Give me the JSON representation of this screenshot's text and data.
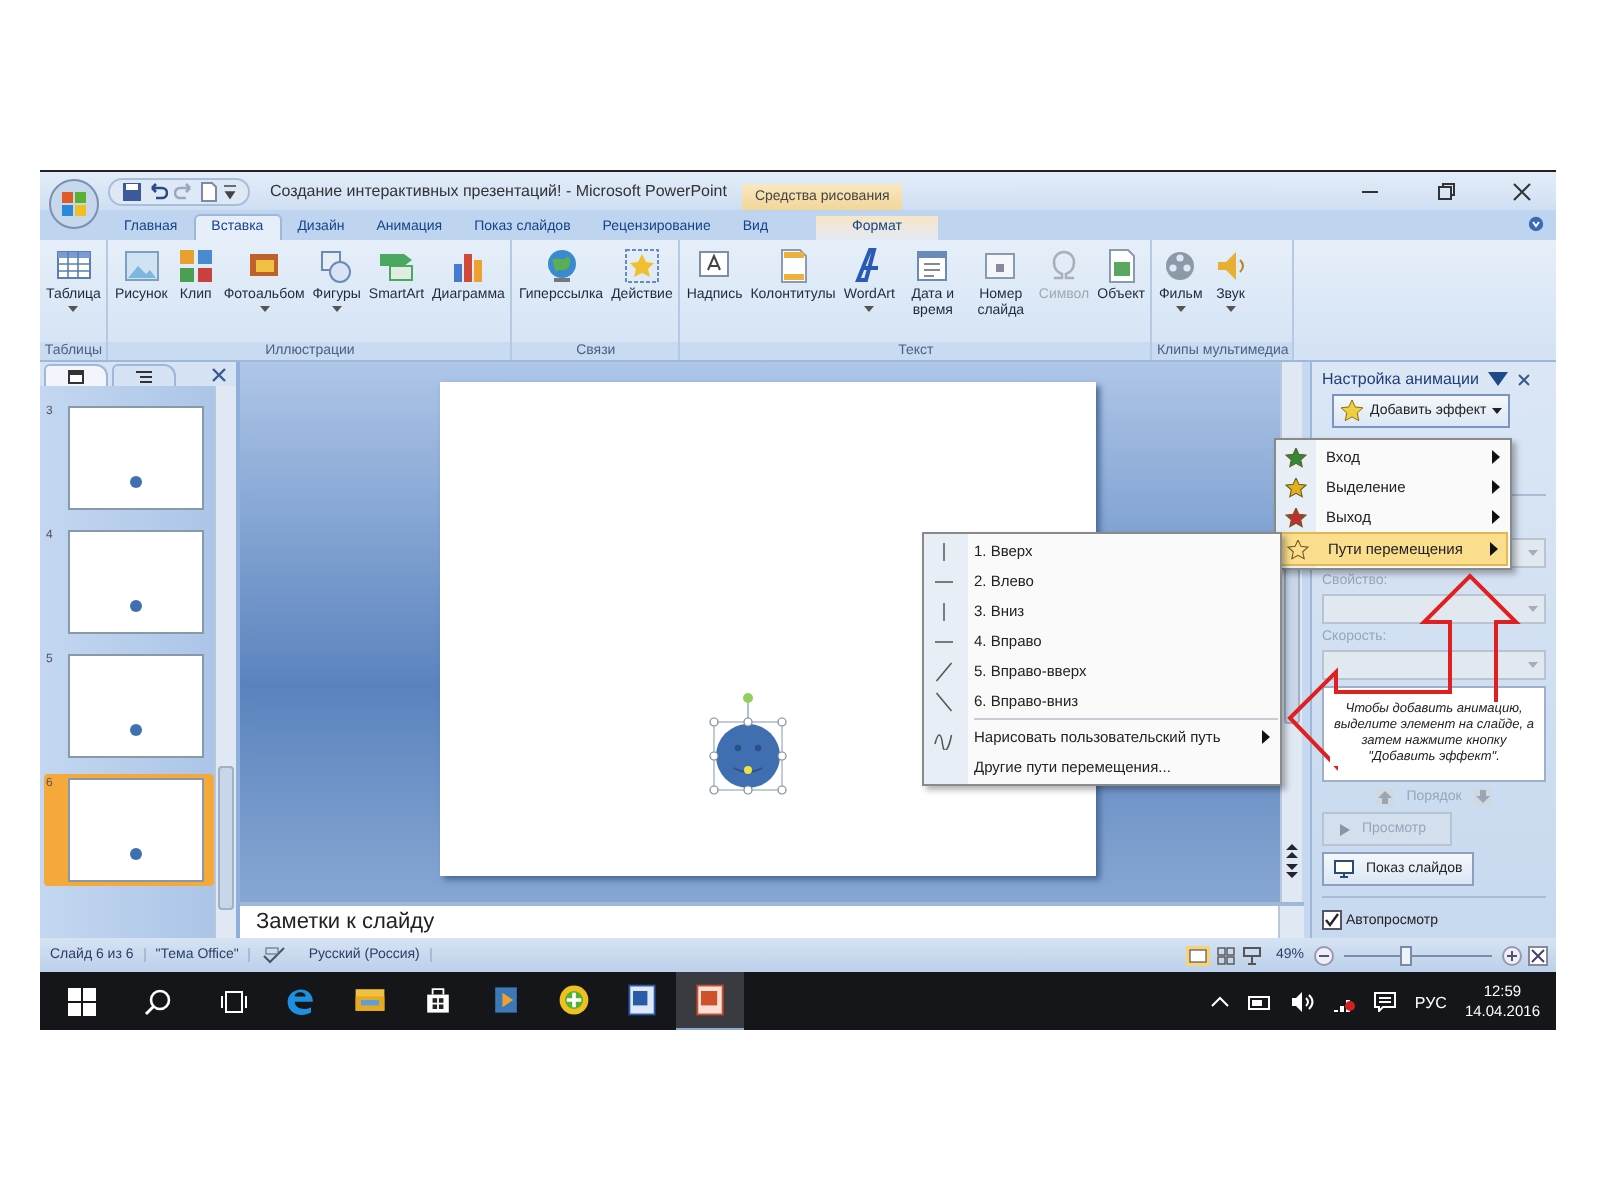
{
  "title_bar": {
    "title": "Создание интерактивных презентаций! - Microsoft PowerPoint",
    "context_tab": "Средства рисования"
  },
  "tabs": [
    {
      "label": "Главная",
      "selected": false,
      "kind": "normal"
    },
    {
      "label": "Вставка",
      "selected": true,
      "kind": "normal"
    },
    {
      "label": "Дизайн",
      "selected": false,
      "kind": "normal"
    },
    {
      "label": "Анимация",
      "selected": false,
      "kind": "normal"
    },
    {
      "label": "Показ слайдов",
      "selected": false,
      "kind": "normal"
    },
    {
      "label": "Рецензирование",
      "selected": false,
      "kind": "normal"
    },
    {
      "label": "Вид",
      "selected": false,
      "kind": "normal"
    },
    {
      "label": "Формат",
      "selected": false,
      "kind": "context"
    }
  ],
  "ribbon": {
    "groups": [
      {
        "name": "Таблицы",
        "buttons": [
          {
            "label": "Таблица",
            "dropdown": true,
            "disabled": false
          }
        ]
      },
      {
        "name": "Иллюстрации",
        "buttons": [
          {
            "label": "Рисунок",
            "dropdown": false,
            "disabled": false
          },
          {
            "label": "Клип",
            "dropdown": false,
            "disabled": false
          },
          {
            "label": "Фотоальбом",
            "dropdown": true,
            "disabled": false
          },
          {
            "label": "Фигуры",
            "dropdown": true,
            "disabled": false
          },
          {
            "label": "SmartArt",
            "dropdown": false,
            "disabled": false
          },
          {
            "label": "Диаграмма",
            "dropdown": false,
            "disabled": false
          }
        ]
      },
      {
        "name": "Связи",
        "buttons": [
          {
            "label": "Гиперссылка",
            "dropdown": false,
            "disabled": false
          },
          {
            "label": "Действие",
            "dropdown": false,
            "disabled": false
          }
        ]
      },
      {
        "name": "Текст",
        "buttons": [
          {
            "label": "Надпись",
            "dropdown": false,
            "disabled": false
          },
          {
            "label": "Колонтитулы",
            "dropdown": false,
            "disabled": false
          },
          {
            "label": "WordArt",
            "dropdown": true,
            "disabled": false
          },
          {
            "label": "Дата и время",
            "dropdown": false,
            "disabled": false
          },
          {
            "label": "Номер слайда",
            "dropdown": false,
            "disabled": false
          },
          {
            "label": "Символ",
            "dropdown": false,
            "disabled": true
          },
          {
            "label": "Объект",
            "dropdown": false,
            "disabled": false
          }
        ]
      },
      {
        "name": "Клипы мультимедиа",
        "buttons": [
          {
            "label": "Фильм",
            "dropdown": true,
            "disabled": false
          },
          {
            "label": "Звук",
            "dropdown": true,
            "disabled": false
          }
        ]
      }
    ]
  },
  "slides_panel": {
    "slides": [
      {
        "number": "3",
        "selected": false
      },
      {
        "number": "4",
        "selected": false
      },
      {
        "number": "5",
        "selected": false
      },
      {
        "number": "6",
        "selected": true
      }
    ]
  },
  "notes": {
    "placeholder": "Заметки к слайду"
  },
  "animation_pane": {
    "title": "Настройка анимации",
    "add_effect": "Добавить эффект",
    "property_label": "Свойство:",
    "speed_label": "Скорость:",
    "hint": "Чтобы добавить анимацию, выделите элемент на слайде, а затем нажмите кнопку \"Добавить эффект\".",
    "order_label": "Порядок",
    "preview_button": "Просмотр",
    "slideshow_button": "Показ слайдов",
    "autopreview": {
      "label": "Автопросмотр",
      "checked": true
    }
  },
  "effects_menu": [
    {
      "label": "Вход",
      "selected": false
    },
    {
      "label": "Выделение",
      "selected": false
    },
    {
      "label": "Выход",
      "selected": false
    },
    {
      "label": "Пути перемещения",
      "selected": true
    }
  ],
  "paths_menu": [
    {
      "label": "1. Вверх",
      "kind": "up",
      "submenu": false
    },
    {
      "label": "2. Влево",
      "kind": "left",
      "submenu": false
    },
    {
      "label": "3. Вниз",
      "kind": "down",
      "submenu": false
    },
    {
      "label": "4. Вправо",
      "kind": "right",
      "submenu": false
    },
    {
      "label": "5. Вправо-вверх",
      "kind": "up-right",
      "submenu": false
    },
    {
      "label": "6. Вправо-вниз",
      "kind": "down-right",
      "submenu": false
    },
    {
      "label": "Нарисовать пользовательский путь",
      "kind": "custom",
      "submenu": true
    },
    {
      "label": "Другие пути перемещения...",
      "kind": "more",
      "submenu": false
    }
  ],
  "status_bar": {
    "slide": "Слайд 6 из 6",
    "theme": "\"Тема Office\"",
    "language": "Русский (Россия)",
    "zoom": "49%",
    "zoom_slider": {
      "level": 0.4
    }
  },
  "taskbar": {
    "apps": [
      {
        "selected": false
      },
      {
        "selected": false
      },
      {
        "selected": false
      },
      {
        "selected": false
      },
      {
        "selected": false
      },
      {
        "selected": false
      },
      {
        "selected": true
      }
    ],
    "language": "РУС",
    "time": "12:59",
    "date": "14.04.2016"
  }
}
